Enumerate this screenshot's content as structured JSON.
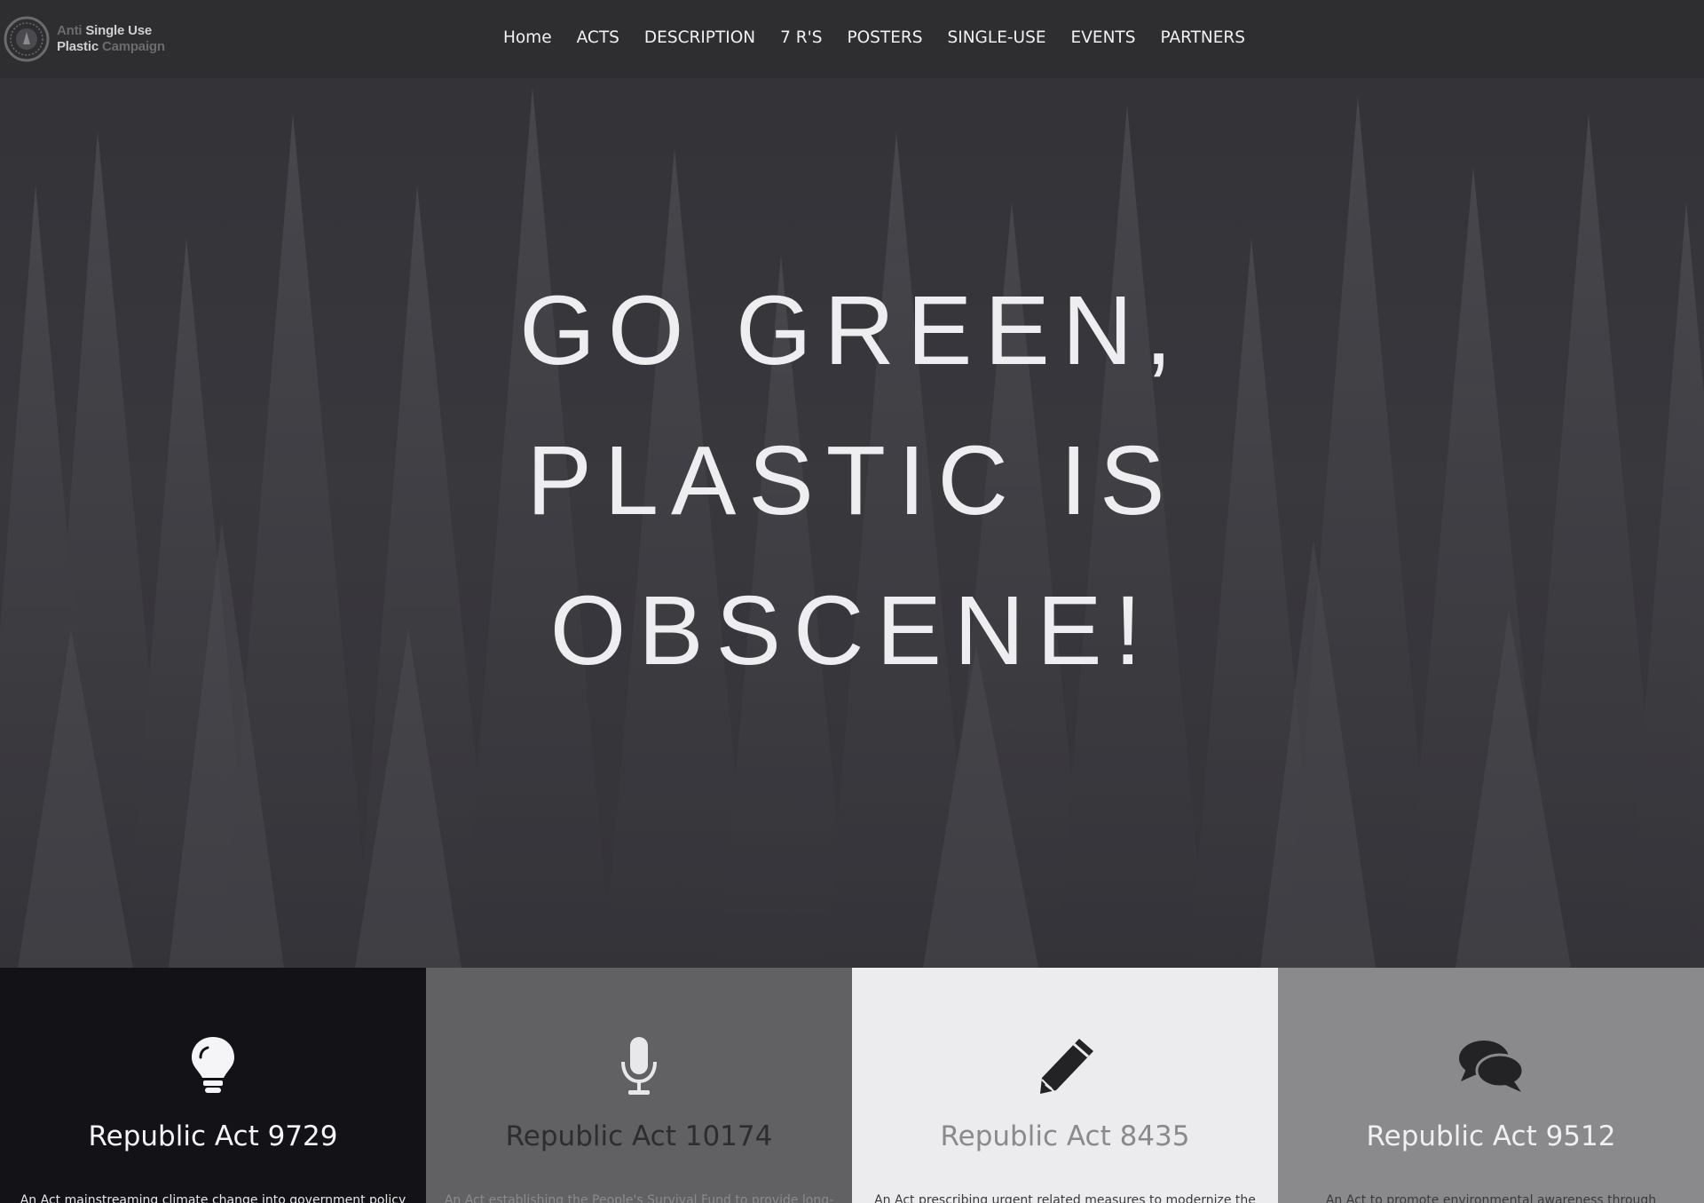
{
  "navbar": {
    "logo": {
      "line1_dim": "Anti",
      "line1": "Single Use",
      "line2": "Plastic",
      "line2_dim": "Campaign"
    },
    "items": [
      {
        "label": "Home"
      },
      {
        "label": "ACTS"
      },
      {
        "label": "DESCRIPTION"
      },
      {
        "label": "7 R'S"
      },
      {
        "label": "POSTERS"
      },
      {
        "label": "SINGLE-USE"
      },
      {
        "label": "EVENTS"
      },
      {
        "label": "PARTNERS"
      }
    ]
  },
  "hero": {
    "lines": [
      "GO GREEN,",
      "PLASTIC IS",
      "OBSCENE!"
    ]
  },
  "features": [
    {
      "icon": "lightbulb-icon",
      "title": "Republic Act 9729",
      "text": "An Act mainstreaming climate change into government policy"
    },
    {
      "icon": "microphone-icon",
      "title": "Republic Act 10174",
      "text": "An Act establishing the People's Survival Fund to provide long-"
    },
    {
      "icon": "pencil-icon",
      "title": "Republic Act 8435",
      "text": "An Act prescribing urgent related measures to modernize the"
    },
    {
      "icon": "comments-icon",
      "title": "Republic Act 9512",
      "text": "An Act to promote environmental awareness through"
    }
  ],
  "colors": {
    "navbar_bg": "#2e2e31",
    "hero_text": "#eeeef0",
    "feature_1_bg": "#131317",
    "feature_2_bg": "#616164",
    "feature_3_bg": "#ececee",
    "feature_4_bg": "#8a8a8c"
  }
}
